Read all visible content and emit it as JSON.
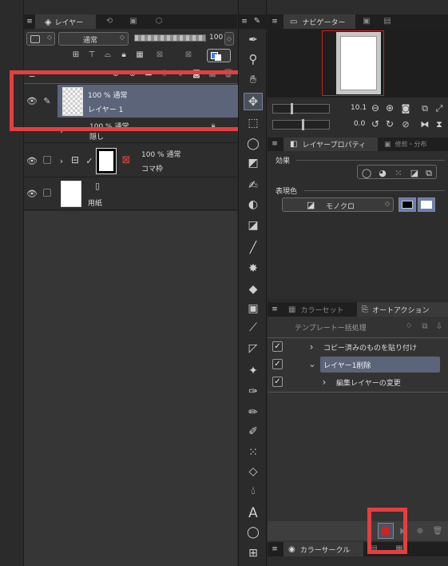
{
  "layers_panel": {
    "tab_label": "レイヤー",
    "blend_mode": "通常",
    "opacity_value": "100",
    "layers": [
      {
        "opacity_mode": "100 % 通常",
        "name": "レイヤー 1"
      },
      {
        "opacity_mode": "100 % 通常",
        "name": "隠し"
      },
      {
        "opacity_mode": "100 % 通常",
        "name": "コマ枠"
      },
      {
        "name": "用紙"
      }
    ]
  },
  "navigator": {
    "tab_label": "ナビゲーター",
    "zoom_value": "10.1",
    "rotation_value": "0.0"
  },
  "layer_property": {
    "tab_label": "レイヤープロパティ",
    "tab2_label": "修剪・分布",
    "effect_label": "効果",
    "expression_color_label": "表現色",
    "expression_color_value": "モノクロ"
  },
  "auto_action": {
    "tab_inactive_label": "カラーセット",
    "tab_active_label": "オートアクション",
    "set_name": "テンプレートー括処理",
    "items": [
      {
        "label": "コピー済みのものを貼り付け"
      },
      {
        "label": "レイヤー1削除"
      },
      {
        "label": "編集レイヤーの変更"
      }
    ]
  },
  "color_circle": {
    "tab_label": "カラーサークル"
  },
  "colors": {
    "highlight": "#e53e3e",
    "selected_row": "#5b6479",
    "record_stop": "#d42020"
  },
  "icons": {
    "toolbar": [
      "eyedropper-icon",
      "zoom-icon",
      "hand-icon",
      "move-icon",
      "selection-icon",
      "lasso-icon",
      "gradient-icon",
      "pen-icon",
      "layer-move-icon",
      "object-icon",
      "line-icon",
      "burst-icon",
      "fill-icon",
      "gradient-tool-icon",
      "ruler-icon",
      "frame-icon",
      "sparkle-icon",
      "pen-nib-icon",
      "pencil-icon",
      "airbrush-icon",
      "spray-icon",
      "eraser-icon",
      "blend-icon",
      "text-icon",
      "balloon-icon",
      "panel-icon"
    ]
  }
}
